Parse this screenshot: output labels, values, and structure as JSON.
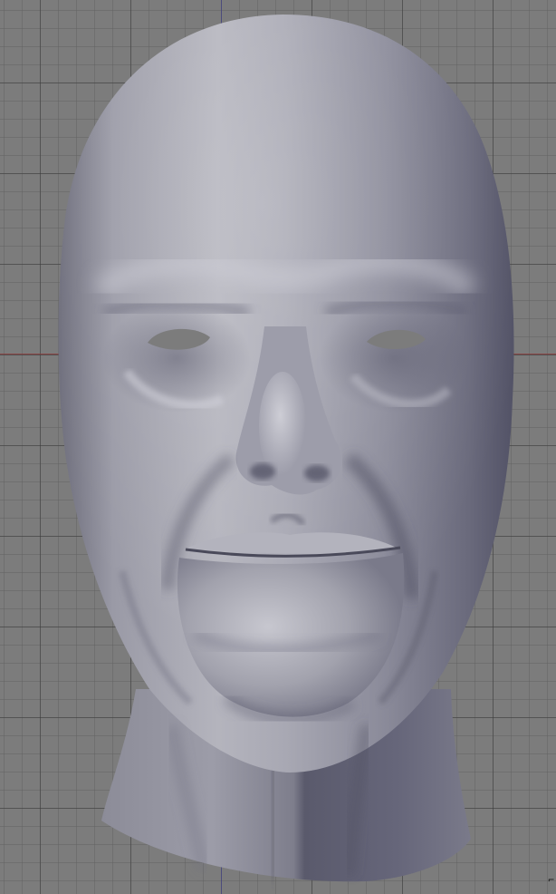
{
  "viewport": {
    "view": "front-orthographic",
    "object": "sculpted-head-mesh",
    "shading": "solid",
    "grid": true,
    "corner_mark": "⌐"
  },
  "colors": {
    "background": "#7c7c7c",
    "grid_major": "#3c3c3c",
    "grid_minor": "#5f5f5f",
    "x_axis": "#8a3a3a",
    "y_axis": "#4a4a8a",
    "mesh_light": "#b9b9c2",
    "mesh_mid": "#8e8e9c",
    "mesh_shadow": "#4b4b5c"
  }
}
